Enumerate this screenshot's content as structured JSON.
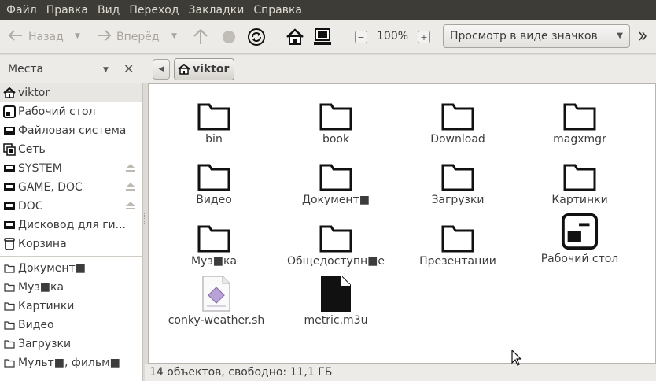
{
  "menubar": {
    "items": [
      "Файл",
      "Правка",
      "Вид",
      "Переход",
      "Закладки",
      "Справка"
    ]
  },
  "toolbar": {
    "back_label": "Назад",
    "forward_label": "Вперёд",
    "zoom_level": "100%",
    "view_mode": "Просмотр в виде значков"
  },
  "sidebar": {
    "header": "Места",
    "places": [
      {
        "label": "viktor",
        "icon": "home-icon",
        "selected": true
      },
      {
        "label": "Рабочий стол",
        "icon": "desktop-icon"
      },
      {
        "label": "Файловая система",
        "icon": "drive-icon"
      },
      {
        "label": "Сеть",
        "icon": "network-icon"
      },
      {
        "label": "SYSTEM",
        "icon": "drive-icon",
        "eject": true
      },
      {
        "label": "GAME, DOC",
        "icon": "drive-icon",
        "eject": true
      },
      {
        "label": "DOC",
        "icon": "drive-icon",
        "eject": true
      },
      {
        "label": "Дисковод для ги...",
        "icon": "floppy-icon"
      },
      {
        "label": "Корзина",
        "icon": "trash-icon"
      }
    ],
    "bookmarks": [
      {
        "label": "Документ■",
        "icon": "folder-icon"
      },
      {
        "label": "Муз■ка",
        "icon": "folder-icon"
      },
      {
        "label": "Картинки",
        "icon": "folder-icon"
      },
      {
        "label": "Видео",
        "icon": "folder-icon"
      },
      {
        "label": "Загрузки",
        "icon": "folder-icon"
      },
      {
        "label": "Мульт■, фильм■",
        "icon": "folder-icon"
      }
    ]
  },
  "pathbar": {
    "crumb": "viktor"
  },
  "files": [
    {
      "name": "bin",
      "icon": "folder-icon"
    },
    {
      "name": "book",
      "icon": "folder-icon"
    },
    {
      "name": "Download",
      "icon": "folder-icon"
    },
    {
      "name": "magxmgr",
      "icon": "folder-icon"
    },
    {
      "name": "Видео",
      "icon": "folder-icon"
    },
    {
      "name": "Документ■",
      "icon": "folder-icon"
    },
    {
      "name": "Загрузки",
      "icon": "folder-icon"
    },
    {
      "name": "Картинки",
      "icon": "folder-icon"
    },
    {
      "name": "Муз■ка",
      "icon": "folder-icon"
    },
    {
      "name": "Общедоступн■е",
      "icon": "folder-icon"
    },
    {
      "name": "Презентации",
      "icon": "folder-icon"
    },
    {
      "name": "Рабочий стол",
      "icon": "desktop-icon"
    },
    {
      "name": "conky-weather.sh",
      "icon": "script-icon"
    },
    {
      "name": "metric.m3u",
      "icon": "document-icon"
    }
  ],
  "statusbar": {
    "text": "14 объектов, свободно: 11,1 ГБ"
  },
  "colors": {
    "menubar_bg": "#3d3c37",
    "menubar_text": "#dfdbd2",
    "window_bg": "#edebe8",
    "view_bg": "#ffffff"
  }
}
